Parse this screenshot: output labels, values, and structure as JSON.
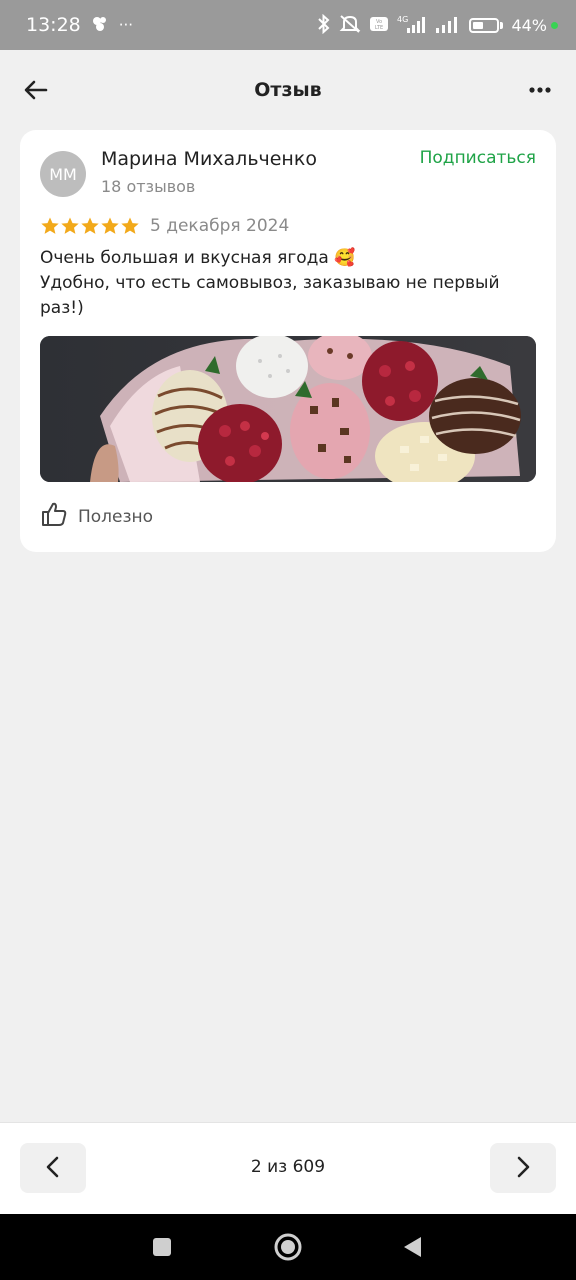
{
  "status_bar": {
    "time": "13:28",
    "more_indicator": "···",
    "battery_percent": "44%",
    "battery_level": 0.44,
    "icons": [
      "app-notification-icon",
      "bluetooth-icon",
      "mute-icon",
      "volte-icon",
      "signal-4g-icon",
      "signal-icon",
      "battery-icon"
    ]
  },
  "header": {
    "title": "Отзыв",
    "back_icon": "arrow-left-icon",
    "menu_icon": "more-horizontal-icon"
  },
  "review": {
    "author_initials": "ММ",
    "author_name": "Марина Михальченко",
    "reviews_count": "18 отзывов",
    "subscribe_label": "Подписаться",
    "rating": 5,
    "rating_max": 5,
    "date": "5 декабря 2024",
    "text_line1": "Очень большая и вкусная ягода 🥰",
    "text_line2": "Удобно, что есть самовывоз, заказываю не первый раз!)",
    "photo_description_icon": "review-photo-strawberries",
    "helpful_label": "Полезно",
    "helpful_icon": "thumbs-up-icon"
  },
  "pager": {
    "counter": "2 из 609",
    "current": 2,
    "total": 609,
    "prev_icon": "chevron-left-icon",
    "next_icon": "chevron-right-icon"
  },
  "navigation_bar": {
    "icons": [
      "recents-square-icon",
      "home-circle-icon",
      "back-triangle-icon"
    ]
  },
  "colors": {
    "accent_green": "#1fa347",
    "star_gold": "#f2a91a",
    "background": "#f0f0f0",
    "status_bar": "#9a9a9a"
  }
}
